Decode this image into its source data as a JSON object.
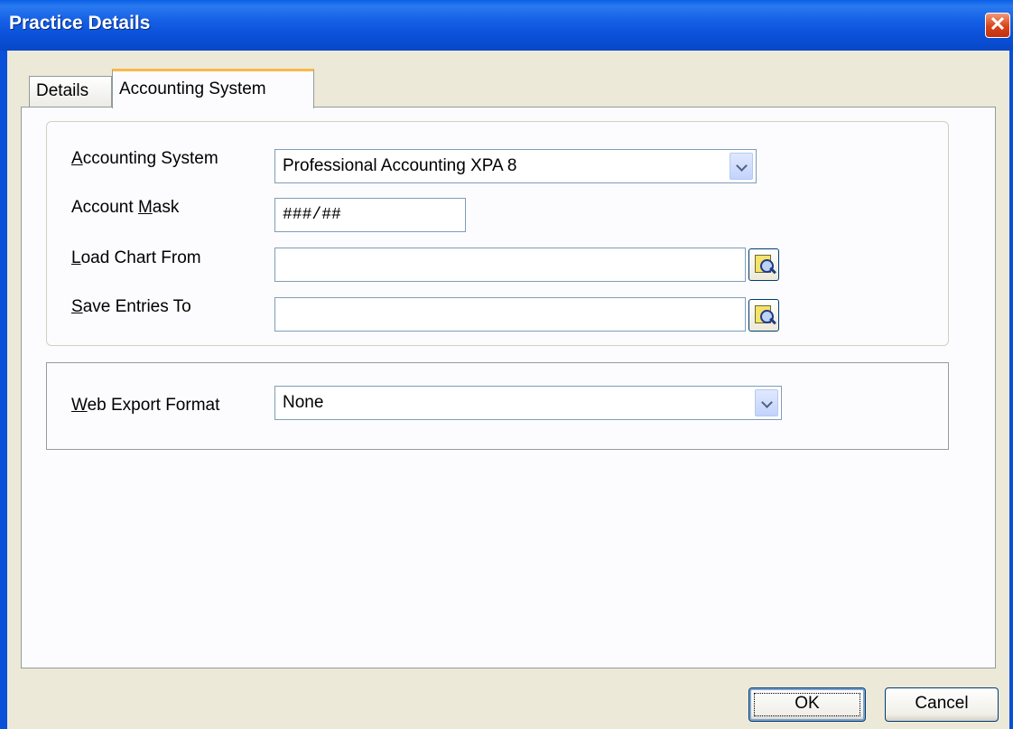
{
  "window": {
    "title": "Practice Details",
    "close_glyph": "✕"
  },
  "tabs": [
    {
      "label": "Details",
      "active": false
    },
    {
      "label": "Accounting System",
      "active": true
    }
  ],
  "form": {
    "accounting_system": {
      "label_prefix": "",
      "label_hotkey": "A",
      "label_rest": "ccounting System",
      "value": "Professional Accounting XPA 8"
    },
    "account_mask": {
      "label_prefix": "Account ",
      "label_hotkey": "M",
      "label_rest": "ask",
      "value": "###/##"
    },
    "load_chart_from": {
      "label_prefix": "",
      "label_hotkey": "L",
      "label_rest": "oad Chart From",
      "value": ""
    },
    "save_entries_to": {
      "label_prefix": "",
      "label_hotkey": "S",
      "label_rest": "ave Entries To",
      "value": ""
    },
    "web_export_format": {
      "label_prefix": "",
      "label_hotkey": "W",
      "label_rest": "eb Export Format",
      "value": "None"
    }
  },
  "buttons": {
    "ok": "OK",
    "cancel": "Cancel"
  },
  "icons": {
    "browse": "browse-folder-icon",
    "dropdown": "chevron-down-icon",
    "close": "close-icon"
  },
  "colors": {
    "titlebar": "#0a50d8",
    "dialog_bg": "#ece9d8",
    "active_tab_accent": "#f9b949",
    "close_button": "#d8431a"
  }
}
